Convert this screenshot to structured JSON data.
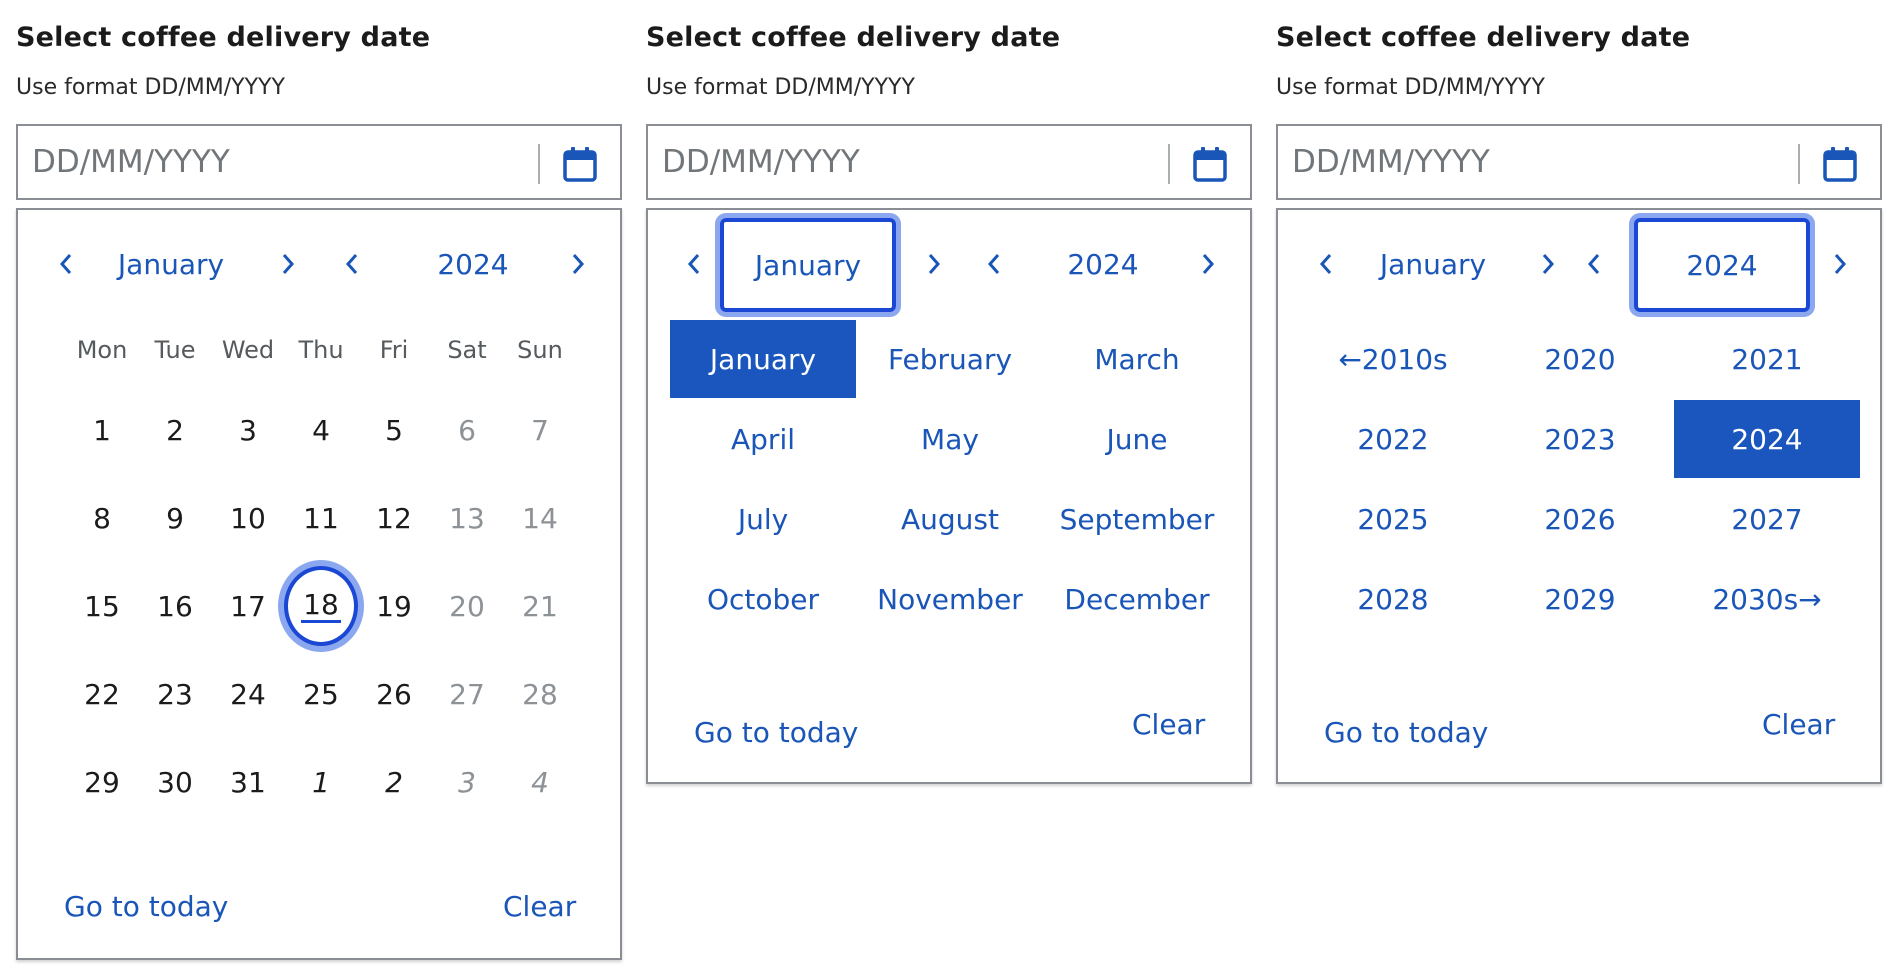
{
  "label": "Select coffee delivery date",
  "hint": "Use format DD/MM/YYYY",
  "input": {
    "value": "",
    "placeholder": "DD/MM/YYYY"
  },
  "nav": {
    "month": "January",
    "year": "2024"
  },
  "weekdays": [
    "Mon",
    "Tue",
    "Wed",
    "Thu",
    "Fri",
    "Sat",
    "Sun"
  ],
  "days": [
    [
      "1",
      "2",
      "3",
      "4",
      "5",
      "6",
      "7"
    ],
    [
      "8",
      "9",
      "10",
      "11",
      "12",
      "13",
      "14"
    ],
    [
      "15",
      "16",
      "17",
      "18",
      "19",
      "20",
      "21"
    ],
    [
      "22",
      "23",
      "24",
      "25",
      "26",
      "27",
      "28"
    ],
    [
      "29",
      "30",
      "31",
      "1",
      "2",
      "3",
      "4"
    ]
  ],
  "today_day": "18",
  "months": [
    "January",
    "February",
    "March",
    "April",
    "May",
    "June",
    "July",
    "August",
    "September",
    "October",
    "November",
    "December"
  ],
  "selected_month": "January",
  "years": [
    "2010s",
    "2020",
    "2021",
    "2022",
    "2023",
    "2024",
    "2025",
    "2026",
    "2027",
    "2028",
    "2029",
    "2030s"
  ],
  "selected_year": "2024",
  "footer": {
    "today_label": "Go to today",
    "clear_label": "Clear"
  },
  "colors": {
    "link": "#1a55b8",
    "selected_bg": "#1a56bd",
    "focus_ring": "#1a47d3",
    "weekend_text": "#8d9297"
  },
  "icons": {
    "calendar": "calendar-icon",
    "prev": "chevron-left-icon",
    "next": "chevron-right-icon",
    "decade_prev": "arrow-left-icon",
    "decade_next": "arrow-right-icon"
  }
}
